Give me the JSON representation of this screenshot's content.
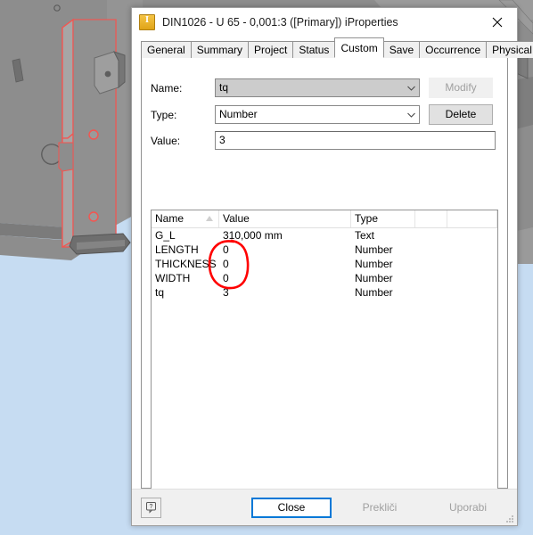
{
  "background": {
    "name": "cad-viewport",
    "bg_color": "#c6dcf2",
    "part_color": "#8b8b8b",
    "highlight_color": "#f4544f"
  },
  "dialog": {
    "title": "DIN1026 - U 65 - 0,001:3 ([Primary]) iProperties",
    "icon": "iproperties-icon",
    "close_label": "close-icon",
    "tabs": [
      {
        "label": "General",
        "active": false
      },
      {
        "label": "Summary",
        "active": false
      },
      {
        "label": "Project",
        "active": false
      },
      {
        "label": "Status",
        "active": false
      },
      {
        "label": "Custom",
        "active": true
      },
      {
        "label": "Save",
        "active": false
      },
      {
        "label": "Occurrence",
        "active": false
      },
      {
        "label": "Physical",
        "active": false
      }
    ],
    "form": {
      "name_label": "Name:",
      "name_value": "tq",
      "type_label": "Type:",
      "type_value": "Number",
      "value_label": "Value:",
      "value_value": "3",
      "modify_button": "Modify",
      "modify_enabled": false,
      "delete_button": "Delete",
      "delete_enabled": true
    },
    "property_list": {
      "columns": [
        "Name",
        "Value",
        "Type",
        "",
        ""
      ],
      "sort_column": "Name",
      "sort_direction": "ascending",
      "rows": [
        {
          "name": "G_L",
          "value": "310,000 mm",
          "type": "Text"
        },
        {
          "name": "LENGTH",
          "value": "0",
          "type": "Number"
        },
        {
          "name": "THICKNESS",
          "value": "0",
          "type": "Number"
        },
        {
          "name": "WIDTH",
          "value": "0",
          "type": "Number"
        },
        {
          "name": "tq",
          "value": "3",
          "type": "Number"
        }
      ]
    },
    "annotation": {
      "shape": "hand-drawn-red-ellipse",
      "color": "#ff0000",
      "encircles": "the three zero values of LENGTH, THICKNESS and WIDTH"
    },
    "footer": {
      "help_label": "?",
      "close_button": "Close",
      "close_is_default": true,
      "cancel_button": "Prekliči",
      "cancel_enabled": false,
      "apply_button": "Uporabi",
      "apply_enabled": false
    }
  }
}
